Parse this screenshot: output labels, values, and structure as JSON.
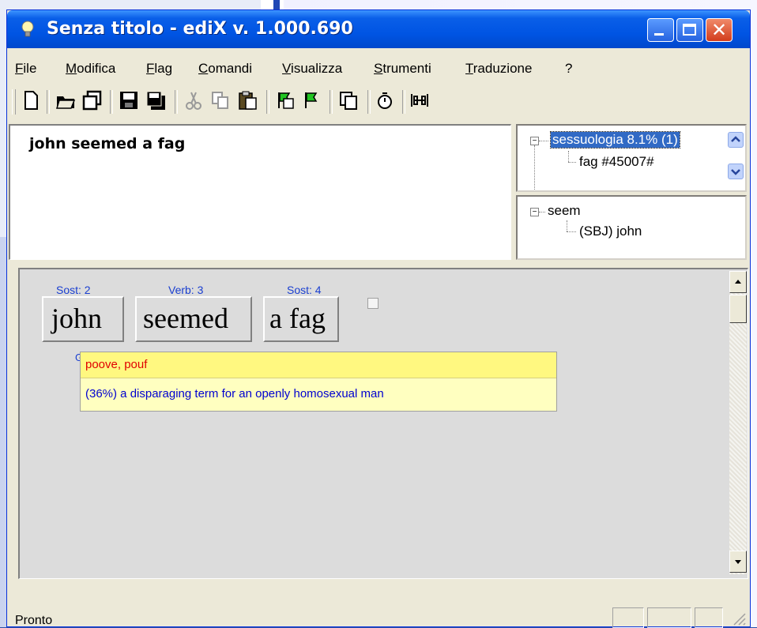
{
  "window": {
    "title": "Senza titolo - ediX v. 1.000.690"
  },
  "menu": [
    "File",
    "Modifica",
    "Flag",
    "Comandi",
    "Visualizza",
    "Strumenti",
    "Traduzione",
    "?"
  ],
  "editor": {
    "text": "john seemed a fag"
  },
  "domain_tree": {
    "node1": "sessuologia 8.1% (1)",
    "child1": "fag #45007#",
    "node2_partial": "..."
  },
  "syntax_tree": {
    "root": "seem",
    "child": "(SBJ) john"
  },
  "tokens": [
    {
      "tag": "Sost: 2",
      "word": "john"
    },
    {
      "tag": "Verb: 3",
      "word": "seemed"
    },
    {
      "tag": "Sost: 4",
      "word": "a fag"
    }
  ],
  "gloss_fragment": "G",
  "tooltip": {
    "synonyms": "poove, pouf",
    "definition": "(36%) a disparaging term for an openly homosexual man"
  },
  "status": {
    "text": "Pronto"
  },
  "icons": {
    "toolbar": [
      "new-icon",
      "open-icon",
      "open-multiple-icon",
      "save-icon",
      "save-all-icon",
      "cut-icon",
      "copy-icon",
      "paste-icon",
      "flag-green-icon",
      "flag-arrow-icon",
      "windows-icon",
      "timer-icon",
      "align-icon"
    ]
  },
  "colors": {
    "selection": "#316ac5",
    "tooltip_top": "#fff880",
    "tooltip_bottom": "#ffffc0",
    "tag_blue": "#1a3fd0"
  }
}
